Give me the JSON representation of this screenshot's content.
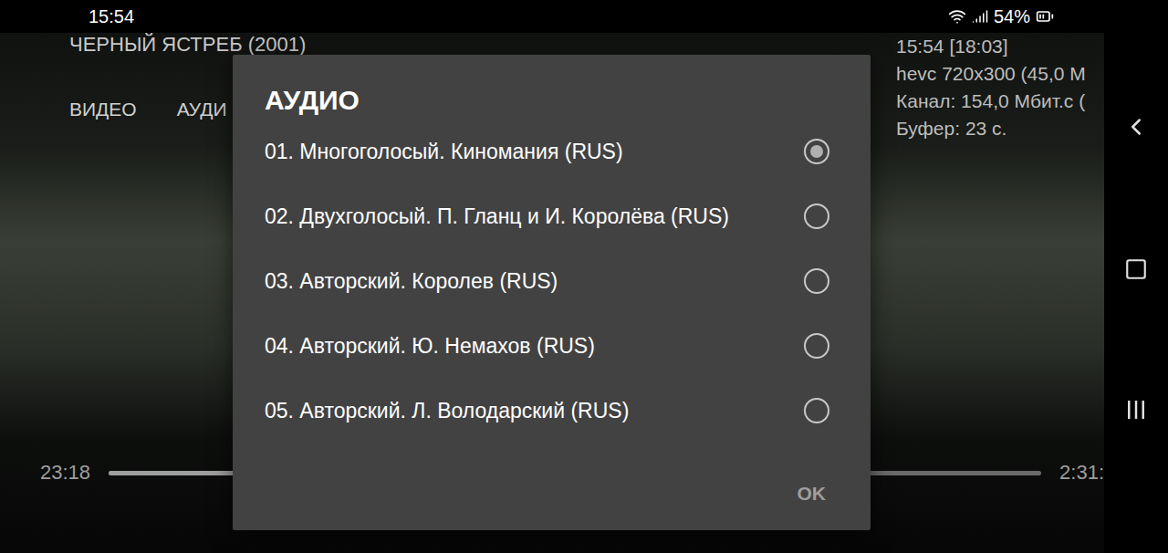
{
  "status_bar": {
    "time": "15:54",
    "battery": "54%"
  },
  "player": {
    "title": "ЧЕРНЫЙ ЯСТРЕБ (2001)",
    "tabs": [
      {
        "label": "ВИДЕО"
      },
      {
        "label": "АУДИ"
      }
    ],
    "info": [
      "15:54  [18:03]",
      "hevc 720x300 (45,0 М",
      "Канал: 154,0 Мбит.с (",
      "Буфер: 23 с."
    ],
    "seek": {
      "elapsed": "23:18",
      "duration": "2:31:",
      "level": 0.154
    }
  },
  "dialog": {
    "title": "АУДИО",
    "options": [
      {
        "label": "01. Многоголосый. Киномания (RUS)",
        "selected": true
      },
      {
        "label": "02. Двухголосый. П. Гланц и И. Королёва (RUS)",
        "selected": false
      },
      {
        "label": "03. Авторский. Королев (RUS)",
        "selected": false
      },
      {
        "label": "04. Авторский. Ю. Немахов (RUS)",
        "selected": false
      },
      {
        "label": "05. Авторский. Л. Володарский (RUS)",
        "selected": false
      }
    ],
    "buttons": [
      "OK"
    ]
  }
}
